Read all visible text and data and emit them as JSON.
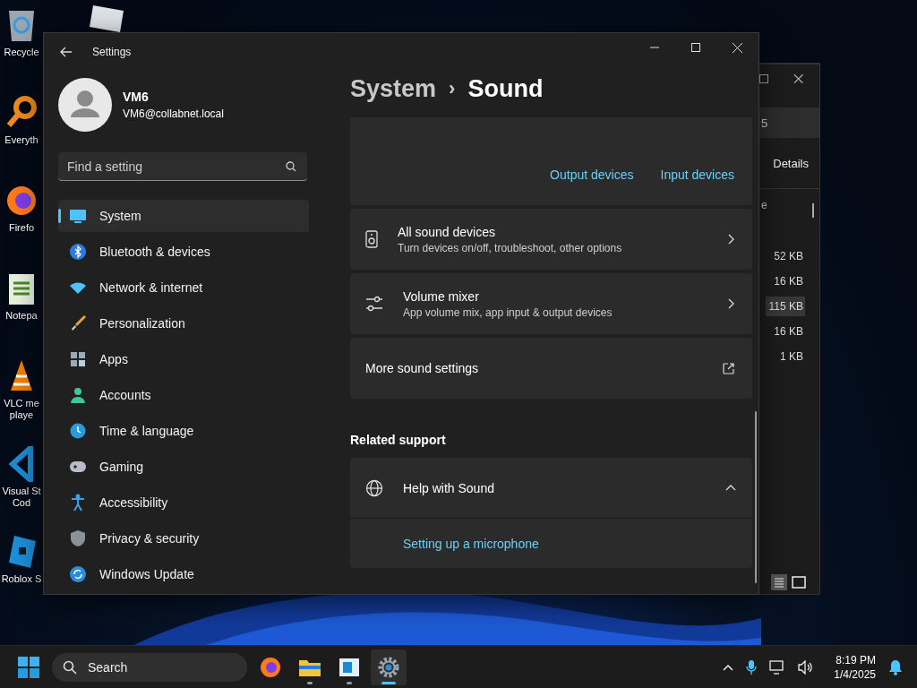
{
  "desktop_icons": [
    {
      "label": "Recycle"
    },
    {
      "label": "Everyth"
    },
    {
      "label": "Firefo"
    },
    {
      "label": "Notepa"
    },
    {
      "label": "VLC me\nplaye"
    },
    {
      "label": "Visual St\nCod"
    },
    {
      "label": "Roblox S"
    }
  ],
  "background_window": {
    "address_fragment": "5",
    "toolbar_button": "Details",
    "column_fragment": "e",
    "rows": [
      {
        "size": "52 KB",
        "selected": false
      },
      {
        "size": "16 KB",
        "selected": false
      },
      {
        "size": "115 KB",
        "selected": true
      },
      {
        "size": "16 KB",
        "selected": false
      },
      {
        "size": "1 KB",
        "selected": false
      }
    ]
  },
  "settings": {
    "title": "Settings",
    "user": {
      "name": "VM6",
      "email": "VM6@collabnet.local"
    },
    "search": {
      "placeholder": "Find a setting"
    },
    "nav": [
      {
        "label": "System",
        "selected": true
      },
      {
        "label": "Bluetooth & devices",
        "selected": false
      },
      {
        "label": "Network & internet",
        "selected": false
      },
      {
        "label": "Personalization",
        "selected": false
      },
      {
        "label": "Apps",
        "selected": false
      },
      {
        "label": "Accounts",
        "selected": false
      },
      {
        "label": "Time & language",
        "selected": false
      },
      {
        "label": "Gaming",
        "selected": false
      },
      {
        "label": "Accessibility",
        "selected": false
      },
      {
        "label": "Privacy & security",
        "selected": false
      },
      {
        "label": "Windows Update",
        "selected": false
      }
    ],
    "breadcrumb": {
      "parent": "System",
      "separator": "›",
      "current": "Sound"
    },
    "device_links": [
      "Output devices",
      "Input devices"
    ],
    "rows": [
      {
        "kind": "speaker",
        "title": "All sound devices",
        "subtitle": "Turn devices on/off, troubleshoot, other options"
      },
      {
        "kind": "mixer",
        "title": "Volume mixer",
        "subtitle": "App volume mix, app input & output devices"
      },
      {
        "kind": "external",
        "title": "More sound settings"
      }
    ],
    "section": "Related support",
    "help": {
      "title": "Help with Sound",
      "expanded": true,
      "links": [
        "Setting up a microphone"
      ]
    }
  },
  "taskbar": {
    "search": "Search",
    "apps": [
      {
        "kind": "firefox",
        "running": false,
        "selected": false
      },
      {
        "kind": "folder",
        "running": true,
        "selected": false
      },
      {
        "kind": "window",
        "running": true,
        "selected": false
      },
      {
        "kind": "gear",
        "running": true,
        "selected": true
      }
    ],
    "time": "8:19 PM",
    "date": "1/4/2025"
  }
}
